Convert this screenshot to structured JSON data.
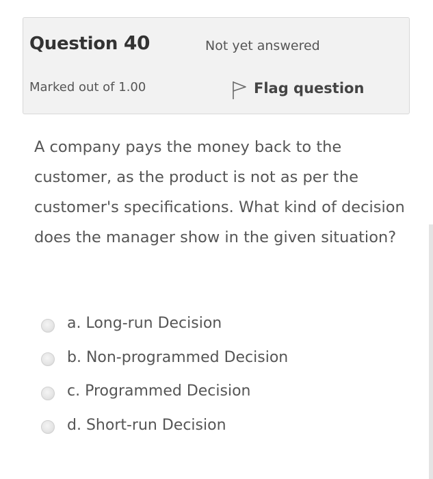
{
  "question": {
    "title_prefix": "Question",
    "number": "40",
    "state": "Not yet answered",
    "grade": "Marked out of 1.00",
    "flag_label": "Flag question",
    "text": "A company pays the money back to the customer, as the product is not as per the customer's specifications. What kind of decision does the manager show in the given situation?"
  },
  "answers": [
    {
      "label": "a. Long-run Decision",
      "selected": false
    },
    {
      "label": "b. Non-programmed Decision",
      "selected": false
    },
    {
      "label": "c. Programmed Decision",
      "selected": false
    },
    {
      "label": "d. Short-run Decision",
      "selected": false
    }
  ],
  "icons": {
    "flag": "flag-outline-icon",
    "radio": "radio-unchecked-icon"
  },
  "colors": {
    "info_background": "#f2f2f2",
    "info_border": "#d8d8d8",
    "text": "#555555",
    "title": "#333333"
  }
}
